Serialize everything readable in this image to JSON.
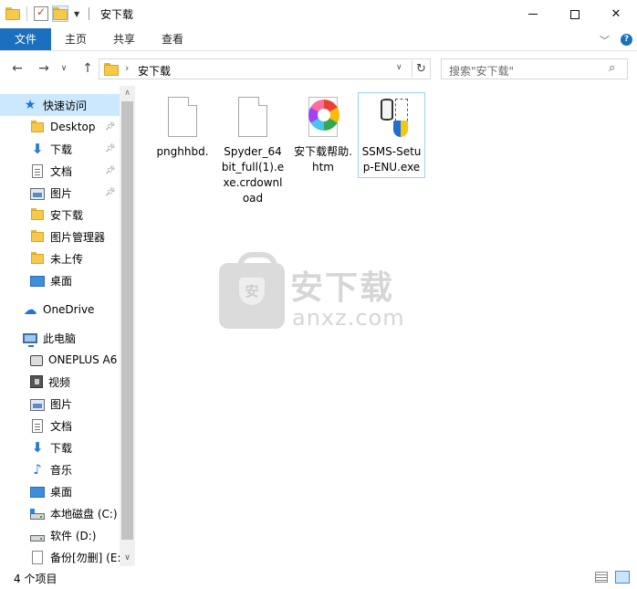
{
  "window": {
    "title": "安下载"
  },
  "ribbon": {
    "tabs": [
      {
        "label": "文件"
      },
      {
        "label": "主页"
      },
      {
        "label": "共享"
      },
      {
        "label": "查看"
      }
    ]
  },
  "address": {
    "path_segment": "安下载",
    "search_placeholder": "搜索\"安下载\""
  },
  "nav_pane": {
    "quick_access": "快速访问",
    "items": [
      {
        "label": "Desktop",
        "icon": "folder-icon",
        "pinned": true
      },
      {
        "label": "下载",
        "icon": "download-icon",
        "pinned": true
      },
      {
        "label": "文档",
        "icon": "document-icon",
        "pinned": true
      },
      {
        "label": "图片",
        "icon": "pictures-icon",
        "pinned": true
      },
      {
        "label": "安下载",
        "icon": "folder-icon",
        "pinned": false
      },
      {
        "label": "图片管理器",
        "icon": "folder-icon",
        "pinned": false
      },
      {
        "label": "未上传",
        "icon": "folder-icon",
        "pinned": false
      },
      {
        "label": "桌面",
        "icon": "desktop-icon",
        "pinned": false
      }
    ],
    "onedrive": "OneDrive",
    "this_pc": "此电脑",
    "pc_items": [
      {
        "label": "ONEPLUS A6",
        "icon": "phone-icon"
      },
      {
        "label": "视频",
        "icon": "video-icon"
      },
      {
        "label": "图片",
        "icon": "pictures-icon"
      },
      {
        "label": "文档",
        "icon": "document-icon"
      },
      {
        "label": "下载",
        "icon": "download-icon"
      },
      {
        "label": "音乐",
        "icon": "music-icon"
      },
      {
        "label": "桌面",
        "icon": "desktop-icon"
      },
      {
        "label": "本地磁盘 (C:)",
        "icon": "system-drive-icon"
      },
      {
        "label": "软件 (D:)",
        "icon": "drive-icon"
      },
      {
        "label": "备份[勿删] (E:",
        "icon": "page-icon"
      }
    ]
  },
  "files": [
    {
      "name": "pnghhbd.",
      "icon": "blank-file-icon"
    },
    {
      "name": "Spyder_64bit_full(1).exe.crdownload",
      "icon": "blank-file-icon"
    },
    {
      "name": "安下载帮助.htm",
      "icon": "chrome-html-icon"
    },
    {
      "name": "SSMS-Setup-ENU.exe",
      "icon": "installer-icon",
      "selected": true
    }
  ],
  "watermark": {
    "cn": "安下载",
    "en": "anxz.com",
    "badge": "安"
  },
  "status": {
    "item_count": "4 个项目"
  },
  "colors": {
    "accent": "#1a6fbf",
    "selection": "#cce8ff",
    "selected_border": "#99d1ff"
  }
}
